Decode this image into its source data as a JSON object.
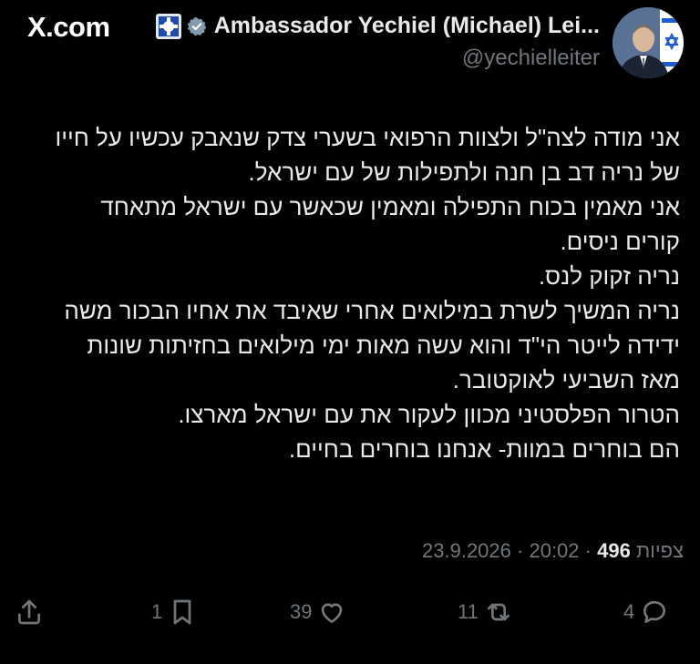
{
  "header": {
    "brand": "X.com",
    "display_name": "Ambassador Yechiel (Michael) Lei...",
    "handle": "@yechielleiter"
  },
  "tweet": {
    "lines": [
      "אני מודה לצה\"ל ולצוות הרפואי בשערי צדק שנאבק עכשיו על חייו",
      "של נריה דב בן חנה ולתפילות של עם ישראל.",
      "אני מאמין בכוח התפילה ומאמין שכאשר עם ישראל מתאחד",
      "קורים ניסים.",
      "נריה זקוק לנס.",
      "נריה המשיך לשרת במילואים אחרי שאיבד את אחיו הבכור משה",
      "ידידה לייטר הי\"ד והוא עשה מאות ימי מילואים בחזיתות שונות",
      "מאז השביעי לאוקטובר.",
      "הטרור הפלסטיני מכוון לעקור את עם ישראל מארצו.",
      "הם בוחרים במוות- אנחנו בוחרים בחיים."
    ]
  },
  "meta": {
    "date": "23.9.2026",
    "time": "20:02",
    "views_count": "496",
    "views_label": "צפיות",
    "separator": "·"
  },
  "actions": {
    "replies": "4",
    "reposts": "11",
    "likes": "39",
    "bookmarks": "1"
  },
  "icons": [
    "x-logo-icon",
    "badge-icon",
    "verified-icon",
    "share-icon",
    "bookmark-icon",
    "like-icon",
    "repost-icon",
    "reply-icon"
  ]
}
